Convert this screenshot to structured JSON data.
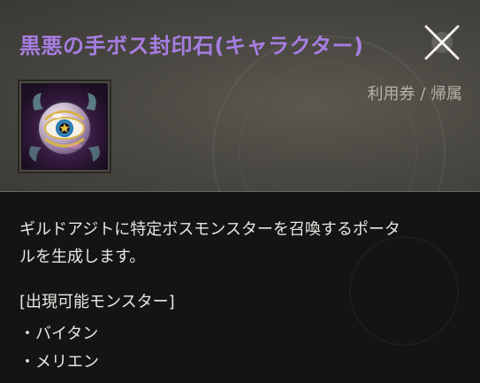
{
  "item": {
    "name": "黒悪の手ボス封印石(キャラクター)",
    "type_label": "利用券 / 帰属",
    "icon": "sealed-eye-orb-icon",
    "description": "ギルドアジトに特定ボスモンスターを召喚するポータルを生成します。",
    "description_line1": "ギルドアジトに特定ボスモンスターを召喚するポータ",
    "description_line2": "ルを生成します。",
    "section_title": "[出現可能モンスター]",
    "monsters": [
      "・バイタン",
      "・メリエン"
    ]
  },
  "colors": {
    "title": "#a77ee2",
    "type_label": "#b5b2a8",
    "body_text": "#e8e6e2"
  },
  "close_icon": "close-x-icon"
}
